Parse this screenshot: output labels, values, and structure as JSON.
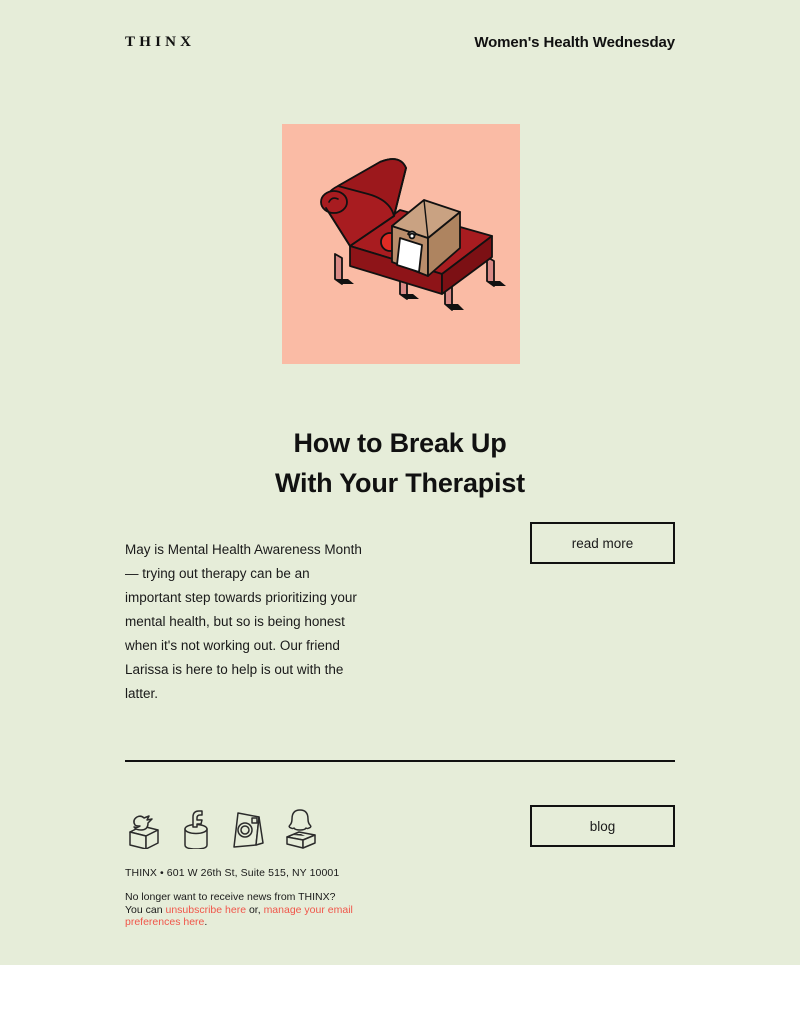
{
  "theme": {
    "page_background": "#ffffff",
    "email_background": "#e6edd9",
    "text_color": "#1a1a1a",
    "link_color": "#f0564a",
    "rule_color": "#111111",
    "hero_background": "#fabba5",
    "couch_red": "#a81c20",
    "couch_red_dark": "#8e1418",
    "couch_red_deep": "#7c1014",
    "box_tan": "#c9a282",
    "box_tan_dark": "#ae8460",
    "pencil_pink": "#ef8a92",
    "note_white": "#ffffff",
    "icon_outline": "#2b2b2b",
    "icon_fill": "#e6edd9"
  },
  "header": {
    "logo_text": "THINX",
    "tagline": "Women's Health Wednesday"
  },
  "hero": {
    "alt_description": "Illustration of a red therapy chaise lounge with a cardboard moving box, a note, a pencil and a red ball on it",
    "icon_name": "therapy-couch-illustration"
  },
  "headline": {
    "line_1": "How to Break Up",
    "line_2": "With Your Therapist"
  },
  "body": {
    "paragraph": "May is Mental Health Awareness Month — trying out therapy can be an important step towards prioritizing your mental health, but so is being honest when it's not working out. Our friend Larissa is here to help is out with the latter.",
    "read_more_label": "read more"
  },
  "footer": {
    "blog_label": "blog",
    "social": [
      {
        "name": "twitter",
        "label": "Twitter"
      },
      {
        "name": "facebook",
        "label": "Facebook"
      },
      {
        "name": "instagram",
        "label": "Instagram"
      },
      {
        "name": "snapchat",
        "label": "Snapchat"
      }
    ],
    "address": "THINX • 601 W 26th St, Suite 515, NY 10001",
    "unsubscribe_prefix": "No longer want to receive news from THINX? You can ",
    "unsubscribe_link": "unsubscribe here",
    "unsubscribe_middle": " or, ",
    "preferences_link": "manage your email preferences here",
    "unsubscribe_suffix": "."
  }
}
